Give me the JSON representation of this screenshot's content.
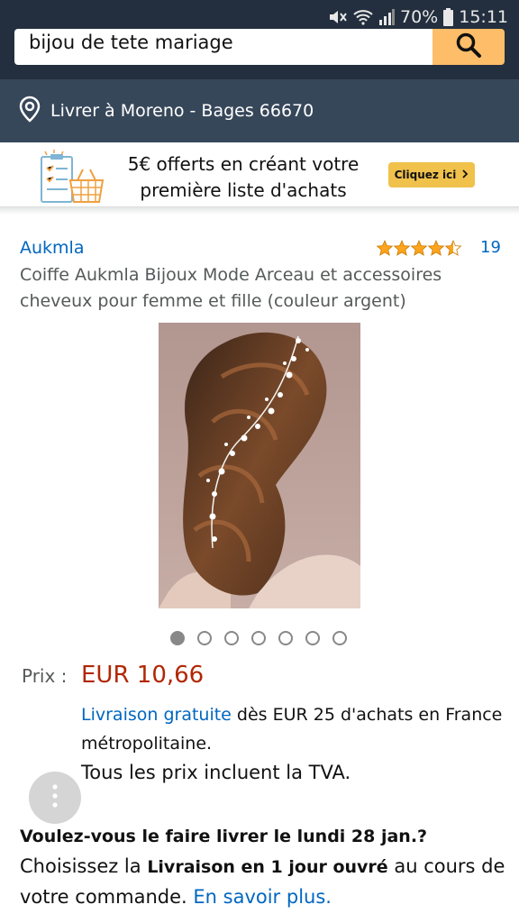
{
  "status_bar": {
    "battery": "70%",
    "time": "15:11"
  },
  "search": {
    "query": "bijou de tete mariage"
  },
  "deliver": {
    "text": "Livrer à Moreno - Bages 66670"
  },
  "promo": {
    "line1": "5€ offerts en créant votre",
    "line2": "première liste d'achats",
    "button_label": "Cliquez ici"
  },
  "product": {
    "brand": "Aukmla",
    "rating_stars": 4.5,
    "rating_count": "19",
    "title": "Coiffe Aukmla Bijoux Mode Arceau et accessoires cheveux pour femme et fille (couleur argent)",
    "image_dots": 7,
    "active_dot": 0,
    "price_label": "Prix :",
    "price": "EUR 10,66",
    "shipping_link": "Livraison gratuite",
    "shipping_rest": " dès EUR 25 d'achats en France métropolitaine.",
    "tva": "Tous les prix incluent la TVA."
  },
  "delivery": {
    "question": "Voulez-vous le faire livrer le lundi 28 jan.?",
    "choose": " Choisissez la ",
    "option": "Livraison en 1 jour ouvré",
    "rest": " au cours de votre commande. ",
    "link": "En savoir plus."
  },
  "colors": {
    "header": "#232f3e",
    "deliver_bar": "#37475a",
    "search_button": "#febd69",
    "price": "#b12704",
    "link": "#0066c0",
    "star": "#ffa41c"
  }
}
